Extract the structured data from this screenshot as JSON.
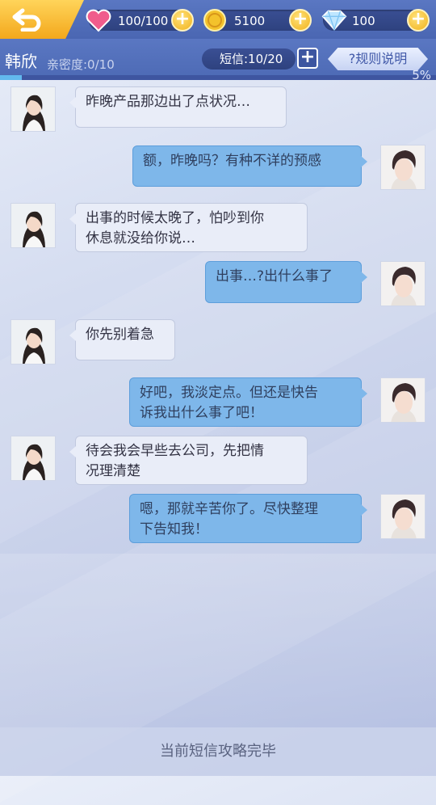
{
  "resources": {
    "hearts": "100/100",
    "gold": "5100",
    "diamonds": "100"
  },
  "contact": {
    "name": "韩欣",
    "intimacy": "亲密度:0/10"
  },
  "sms": {
    "count": "短信:10/20",
    "add_label": "+",
    "rules_label": "?规则说明"
  },
  "progress": {
    "percent_value": 5,
    "label": "5%"
  },
  "messages": [
    {
      "from": "her",
      "text1": "昨晚产品那边出了点状况…",
      "text2": ""
    },
    {
      "from": "me",
      "text1": "额，昨晚吗？有种不详的预感",
      "text2": ""
    },
    {
      "from": "her",
      "text1": "出事的时候太晚了，怕吵到你",
      "text2": "休息就没给你说…"
    },
    {
      "from": "me",
      "text1": "出事…?出什么事了",
      "text2": ""
    },
    {
      "from": "her",
      "text1": "你先别着急",
      "text2": ""
    },
    {
      "from": "me",
      "text1": "好吧，我淡定点。但还是快告",
      "text2": "诉我出什么事了吧！"
    },
    {
      "from": "her",
      "text1": "待会我会早些去公司，先把情",
      "text2": "况理清楚"
    },
    {
      "from": "me",
      "text1": "嗯，那就辛苦你了。尽快整理",
      "text2": "下告知我！"
    }
  ],
  "footer": {
    "status": "当前短信攻略完毕"
  },
  "colors": {
    "topbar": "#4a66b2",
    "my_bubble": "#7eb7ea",
    "her_bubble": "#e9edf8",
    "gold": "#f1b21c"
  },
  "icons": [
    "back-arrow-icon",
    "heart-icon",
    "gold-coin-icon",
    "diamond-icon",
    "plus-icon"
  ]
}
